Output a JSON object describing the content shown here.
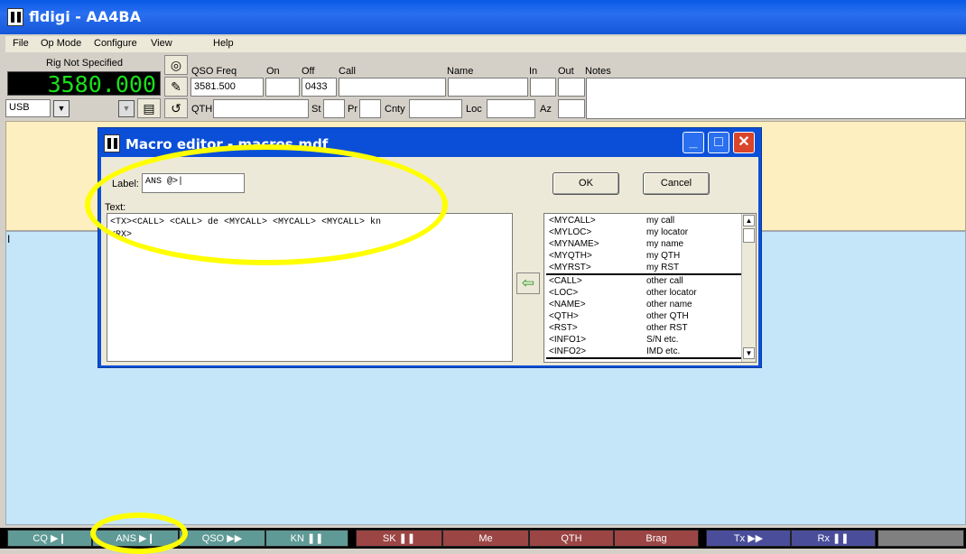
{
  "window": {
    "title": "fldigi - AA4BA"
  },
  "menu": [
    {
      "label": "File"
    },
    {
      "label": "Op Mode"
    },
    {
      "label": "Configure"
    },
    {
      "label": "View"
    },
    {
      "label": "Help"
    }
  ],
  "rig": {
    "name": "Rig Not Specified",
    "frequency": "3580.000",
    "mode": "USB"
  },
  "qso": {
    "labels": {
      "freq": "QSO Freq",
      "on": "On",
      "off": "Off",
      "call": "Call",
      "name": "Name",
      "in": "In",
      "out": "Out",
      "notes": "Notes",
      "qth": "QTH",
      "st": "St",
      "pr": "Pr",
      "cnty": "Cnty",
      "loc": "Loc",
      "az": "Az"
    },
    "freq_value": "3581.500",
    "off_value": "0433"
  },
  "dialog": {
    "title": "Macro editor - macros.mdf",
    "label_caption": "Label:",
    "label_value": "ANS @>|",
    "text_caption": "Text:",
    "text_value": "<TX><CALL> <CALL> de <MYCALL> <MYCALL> <MYCALL> kn\n<RX>",
    "ok": "OK",
    "cancel": "Cancel",
    "tags": [
      {
        "tag": "<MYCALL>",
        "desc": "my call"
      },
      {
        "tag": "<MYLOC>",
        "desc": "my locator"
      },
      {
        "tag": "<MYNAME>",
        "desc": "my name"
      },
      {
        "tag": "<MYQTH>",
        "desc": "my QTH"
      },
      {
        "tag": "<MYRST>",
        "desc": "my RST"
      },
      {
        "tag": "<CALL>",
        "desc": "other call"
      },
      {
        "tag": "<LOC>",
        "desc": "other locator"
      },
      {
        "tag": "<NAME>",
        "desc": "other name"
      },
      {
        "tag": "<QTH>",
        "desc": "other QTH"
      },
      {
        "tag": "<RST>",
        "desc": "other RST"
      },
      {
        "tag": "<INFO1>",
        "desc": "S/N etc."
      },
      {
        "tag": "<INFO2>",
        "desc": "IMD etc."
      }
    ]
  },
  "macros": [
    {
      "label": "CQ",
      "icon": "play-pause",
      "color": "#5f9a96"
    },
    {
      "label": "ANS",
      "icon": "play-pause",
      "color": "#5f9a96"
    },
    {
      "label": "QSO",
      "icon": "fast-forward",
      "color": "#5f9a96"
    },
    {
      "label": "KN",
      "icon": "pause",
      "color": "#5f9a96"
    },
    {
      "label": "SK",
      "icon": "pause",
      "color": "#9b4545"
    },
    {
      "label": "Me",
      "icon": "",
      "color": "#9b4545"
    },
    {
      "label": "QTH",
      "icon": "",
      "color": "#9b4545"
    },
    {
      "label": "Brag",
      "icon": "",
      "color": "#9b4545"
    },
    {
      "label": "Tx",
      "icon": "fast-forward",
      "color": "#4a4e9a"
    },
    {
      "label": "Rx",
      "icon": "pause",
      "color": "#4a4e9a"
    }
  ]
}
